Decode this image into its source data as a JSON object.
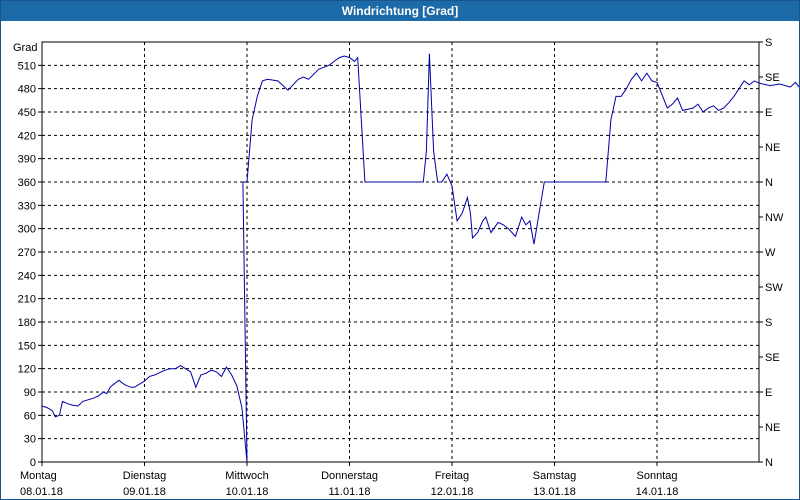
{
  "window": {
    "title": "Windrichtung [Grad]"
  },
  "chart_data": {
    "type": "line",
    "title": "Windrichtung [Grad]",
    "ylabel": "Grad",
    "ylim": [
      0,
      540
    ],
    "grid": true,
    "y_ticks": [
      0,
      30,
      60,
      90,
      120,
      150,
      180,
      210,
      240,
      270,
      300,
      330,
      360,
      390,
      420,
      450,
      480,
      510
    ],
    "right_axis_ticks": [
      {
        "value": 0,
        "label": "N"
      },
      {
        "value": 45,
        "label": "NE"
      },
      {
        "value": 90,
        "label": "E"
      },
      {
        "value": 135,
        "label": "SE"
      },
      {
        "value": 180,
        "label": "S"
      },
      {
        "value": 225,
        "label": "SW"
      },
      {
        "value": 270,
        "label": "W"
      },
      {
        "value": 315,
        "label": "NW"
      },
      {
        "value": 360,
        "label": "N"
      },
      {
        "value": 405,
        "label": "NE"
      },
      {
        "value": 450,
        "label": "E"
      },
      {
        "value": 495,
        "label": "SE"
      },
      {
        "value": 540,
        "label": "S"
      }
    ],
    "x_ticks": [
      {
        "day": "Montag",
        "date": "08.01.18"
      },
      {
        "day": "Dienstag",
        "date": "09.01.18"
      },
      {
        "day": "Mittwoch",
        "date": "10.01.18"
      },
      {
        "day": "Donnerstag",
        "date": "11.01.18"
      },
      {
        "day": "Freitag",
        "date": "12.01.18"
      },
      {
        "day": "Samstag",
        "date": "13.01.18"
      },
      {
        "day": "Sonntag",
        "date": "14.01.18"
      }
    ],
    "series": [
      {
        "color": "#0000aa",
        "points": [
          [
            0.0,
            72
          ],
          [
            0.05,
            70
          ],
          [
            0.1,
            66
          ],
          [
            0.13,
            58
          ],
          [
            0.17,
            60
          ],
          [
            0.2,
            78
          ],
          [
            0.25,
            75
          ],
          [
            0.3,
            73
          ],
          [
            0.35,
            72
          ],
          [
            0.4,
            78
          ],
          [
            0.45,
            80
          ],
          [
            0.5,
            82
          ],
          [
            0.55,
            85
          ],
          [
            0.6,
            90
          ],
          [
            0.63,
            88
          ],
          [
            0.67,
            97
          ],
          [
            0.7,
            100
          ],
          [
            0.75,
            105
          ],
          [
            0.8,
            100
          ],
          [
            0.83,
            98
          ],
          [
            0.87,
            96
          ],
          [
            0.9,
            96
          ],
          [
            0.95,
            100
          ],
          [
            1.0,
            104
          ],
          [
            1.05,
            110
          ],
          [
            1.1,
            112
          ],
          [
            1.15,
            115
          ],
          [
            1.2,
            118
          ],
          [
            1.25,
            120
          ],
          [
            1.3,
            120
          ],
          [
            1.35,
            124
          ],
          [
            1.4,
            120
          ],
          [
            1.45,
            116
          ],
          [
            1.5,
            96
          ],
          [
            1.55,
            112
          ],
          [
            1.6,
            114
          ],
          [
            1.65,
            118
          ],
          [
            1.7,
            116
          ],
          [
            1.75,
            110
          ],
          [
            1.8,
            122
          ],
          [
            1.85,
            112
          ],
          [
            1.9,
            98
          ],
          [
            1.95,
            70
          ],
          [
            2.0,
            0
          ],
          [
            1.96,
            360
          ],
          [
            2.0,
            360
          ],
          [
            2.05,
            440
          ],
          [
            2.1,
            470
          ],
          [
            2.15,
            490
          ],
          [
            2.2,
            492
          ],
          [
            2.3,
            490
          ],
          [
            2.4,
            478
          ],
          [
            2.5,
            492
          ],
          [
            2.55,
            495
          ],
          [
            2.6,
            492
          ],
          [
            2.7,
            505
          ],
          [
            2.8,
            510
          ],
          [
            2.85,
            515
          ],
          [
            2.9,
            520
          ],
          [
            2.95,
            522
          ],
          [
            3.0,
            520
          ],
          [
            3.05,
            515
          ],
          [
            3.08,
            520
          ],
          [
            3.15,
            360
          ],
          [
            3.3,
            360
          ],
          [
            3.45,
            360
          ],
          [
            3.6,
            360
          ],
          [
            3.7,
            360
          ],
          [
            3.72,
            360
          ],
          [
            3.75,
            400
          ],
          [
            3.78,
            525
          ],
          [
            3.82,
            400
          ],
          [
            3.86,
            360
          ],
          [
            3.9,
            360
          ],
          [
            3.95,
            370
          ],
          [
            4.0,
            355
          ],
          [
            4.05,
            310
          ],
          [
            4.1,
            320
          ],
          [
            4.15,
            340
          ],
          [
            4.18,
            320
          ],
          [
            4.2,
            288
          ],
          [
            4.25,
            295
          ],
          [
            4.3,
            310
          ],
          [
            4.33,
            315
          ],
          [
            4.38,
            295
          ],
          [
            4.45,
            308
          ],
          [
            4.5,
            305
          ],
          [
            4.55,
            300
          ],
          [
            4.62,
            290
          ],
          [
            4.68,
            315
          ],
          [
            4.72,
            305
          ],
          [
            4.76,
            310
          ],
          [
            4.8,
            280
          ],
          [
            4.85,
            320
          ],
          [
            4.9,
            360
          ],
          [
            5.0,
            360
          ],
          [
            5.15,
            360
          ],
          [
            5.3,
            360
          ],
          [
            5.4,
            360
          ],
          [
            5.5,
            360
          ],
          [
            5.55,
            440
          ],
          [
            5.6,
            470
          ],
          [
            5.65,
            470
          ],
          [
            5.7,
            480
          ],
          [
            5.75,
            492
          ],
          [
            5.8,
            500
          ],
          [
            5.85,
            490
          ],
          [
            5.9,
            500
          ],
          [
            5.95,
            490
          ],
          [
            6.0,
            488
          ],
          [
            6.05,
            472
          ],
          [
            6.1,
            455
          ],
          [
            6.15,
            460
          ],
          [
            6.2,
            468
          ],
          [
            6.25,
            452
          ],
          [
            6.35,
            455
          ],
          [
            6.4,
            460
          ],
          [
            6.45,
            450
          ],
          [
            6.5,
            455
          ],
          [
            6.55,
            458
          ],
          [
            6.6,
            452
          ],
          [
            6.65,
            455
          ],
          [
            6.7,
            462
          ],
          [
            6.75,
            470
          ],
          [
            6.8,
            480
          ],
          [
            6.85,
            490
          ],
          [
            6.9,
            485
          ],
          [
            6.95,
            490
          ],
          [
            7.0,
            487
          ],
          [
            7.1,
            484
          ],
          [
            7.2,
            486
          ],
          [
            7.3,
            482
          ],
          [
            7.35,
            488
          ],
          [
            7.4,
            480
          ],
          [
            7.45,
            480
          ]
        ]
      }
    ]
  }
}
